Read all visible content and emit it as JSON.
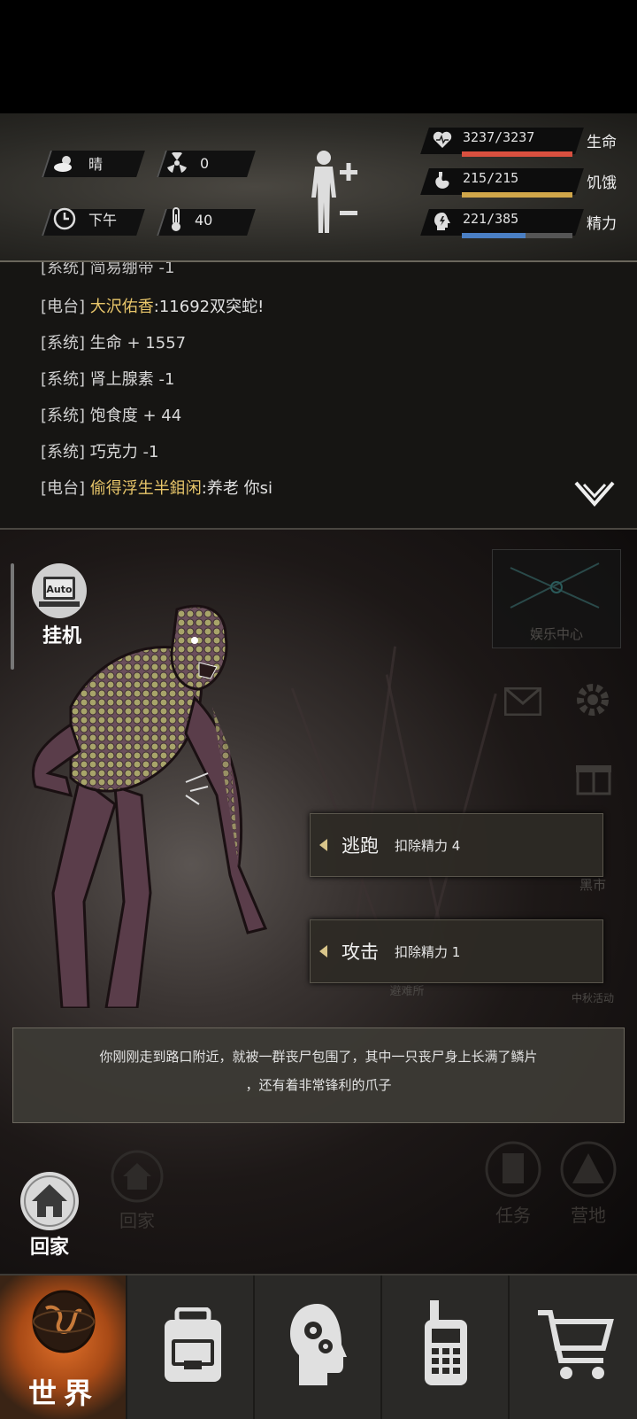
{
  "status": {
    "weather": "晴",
    "radiation": "0",
    "time_of_day": "下午",
    "temperature": "40",
    "stats": [
      {
        "value": "3237/3237",
        "label": "生命",
        "fill": 1.0,
        "color": "#d9503f",
        "icon": "heart-icon"
      },
      {
        "value": "215/215",
        "label": "饥饿",
        "fill": 1.0,
        "color": "#d0a64a",
        "icon": "stomach-icon"
      },
      {
        "value": "221/385",
        "label": "精力",
        "fill": 0.574,
        "color": "#4a7fc4",
        "icon": "energy-head-icon"
      }
    ]
  },
  "log": {
    "partial_line": "[系统] 简易绷带 -1",
    "lines": [
      {
        "tag": "[电台]",
        "type": "radio",
        "name": "大沢佑香",
        "text": ":11692双突蛇!"
      },
      {
        "tag": "[系统]",
        "type": "system",
        "text": "生命 + 1557"
      },
      {
        "tag": "[系统]",
        "type": "system",
        "text": "肾上腺素 -1"
      },
      {
        "tag": "[系统]",
        "type": "system",
        "text": "饱食度 + 44"
      },
      {
        "tag": "[系统]",
        "type": "system",
        "text": "巧克力 -1"
      },
      {
        "tag": "[电台]",
        "type": "radio",
        "name": "偷得浮生半鉬闲",
        "text": ":养老 你si"
      }
    ]
  },
  "scene": {
    "auto_label": "挂机",
    "auto_badge": "Auto",
    "entertainment": "娱乐中心",
    "black_market": "黑市",
    "mid_autumn": "中秋活动",
    "shelter_sign": "避难所",
    "home_label": "回家",
    "home_label_dim": "回家",
    "task_label": "任务",
    "camp_label": "营地",
    "actions": [
      {
        "name": "逃跑",
        "cost": "扣除精力 4"
      },
      {
        "name": "攻击",
        "cost": "扣除精力 1"
      }
    ],
    "narration_line1": "你刚刚走到路口附近，就被一群丧尸包围了，其中一只丧尸身上长满了鳞片",
    "narration_line2": "，还有着非常锋利的爪子"
  },
  "nav": {
    "world_label": "世界",
    "items": [
      "world-icon",
      "backpack-icon",
      "skills-head-icon",
      "radio-icon",
      "shop-cart-icon"
    ]
  }
}
